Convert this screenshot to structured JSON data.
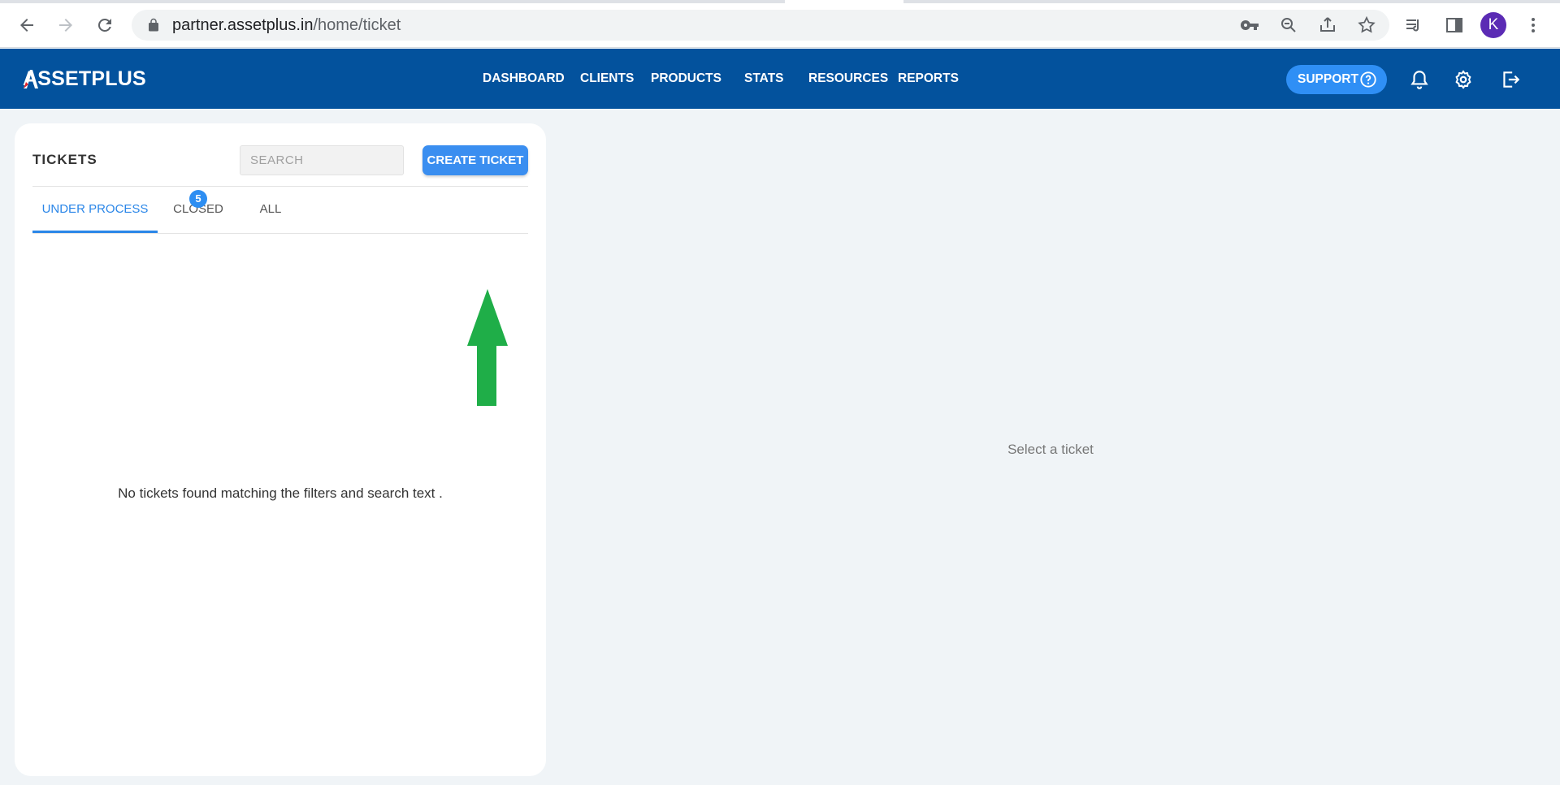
{
  "browser": {
    "url_host": "partner.assetplus.in",
    "url_path": "/home/ticket",
    "avatar_letter": "K",
    "avatar_color": "#5b2bb4"
  },
  "header": {
    "logo": "ASSETPLUS",
    "nav": [
      {
        "label": "DASHBOARD"
      },
      {
        "label": "CLIENTS"
      },
      {
        "label": "PRODUCTS"
      },
      {
        "label": "STATS"
      },
      {
        "label": "RESOURCES"
      },
      {
        "label": "REPORTS"
      }
    ],
    "support_label": "SUPPORT",
    "bg_color": "#03529d",
    "accent_color": "#2f8ff5"
  },
  "tickets": {
    "title": "TICKETS",
    "search_placeholder": "SEARCH",
    "create_label": "CREATE TICKET",
    "tabs": [
      {
        "label": "UNDER PROCESS",
        "active": true
      },
      {
        "label": "CLOSED",
        "badge": "5"
      },
      {
        "label": "ALL"
      }
    ],
    "empty_message": "No tickets found matching the filters and search text ."
  },
  "detail": {
    "placeholder": "Select a ticket"
  },
  "annotation": {
    "arrow_color": "#1fae48",
    "arrow_icon": "up-arrow-icon"
  }
}
